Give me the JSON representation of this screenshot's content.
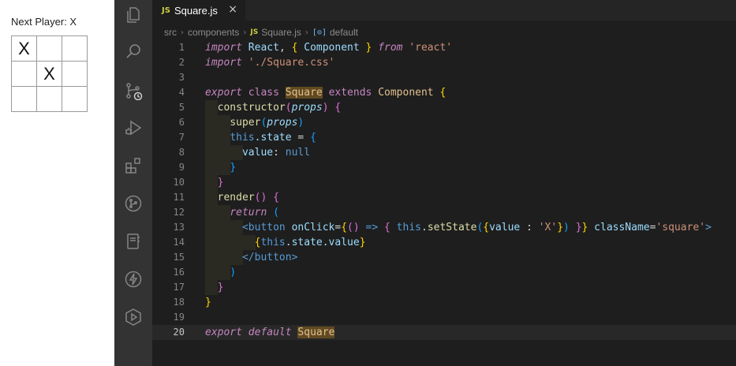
{
  "game": {
    "status": "Next Player: X",
    "board": [
      [
        "X",
        "",
        ""
      ],
      [
        "",
        "X",
        ""
      ],
      [
        "",
        "",
        ""
      ]
    ]
  },
  "activity_bar": [
    "files-icon",
    "search-icon",
    "source-control-icon",
    "run-debug-icon",
    "extensions-icon",
    "github-icon",
    "notebook-icon",
    "lightning-icon",
    "play-icon"
  ],
  "tab": {
    "badge": "JS",
    "name": "Square.js",
    "close": "×"
  },
  "breadcrumb": {
    "items": [
      "src",
      "components",
      "Square.js",
      "default"
    ],
    "js_badge": "JS",
    "symbol_icon": "[⊙]"
  },
  "code": {
    "line_numbers": [
      "1",
      "2",
      "3",
      "4",
      "5",
      "6",
      "7",
      "8",
      "9",
      "10",
      "11",
      "12",
      "13",
      "14",
      "15",
      "16",
      "17",
      "18",
      "19",
      "20"
    ],
    "t": {
      "import": "import",
      "react_ident": "React",
      "comma": ",",
      "lbrace": "{",
      "rbrace": "}",
      "component": "Component",
      "from": "from",
      "react_str": "'react'",
      "css_str": "'./Square.css'",
      "export": "export",
      "class": "class",
      "square": "Square",
      "extends": "extends",
      "constructor": "constructor",
      "lparen": "(",
      "rparen": ")",
      "props": "props",
      "super": "super",
      "this": "this",
      "dot_state": ".state",
      "eq": "=",
      "value": "value",
      "colon": ":",
      "null": "null",
      "render": "render",
      "return": "return",
      "lt": "<",
      "button": "button",
      "onclick": "onClick",
      "arrow": "=>",
      "set_state": "setState",
      "x_str": "'X'",
      "classname": "className",
      "square_str": "'square'",
      "gt": ">",
      "state_value": "state.value",
      "close_button": "</button>",
      "default": "default"
    }
  },
  "colors": {
    "editor_bg": "#1e1e1e",
    "activity_bg": "#333333",
    "keyword": "#c586c0",
    "class": "#e2c08d",
    "string": "#ce9178",
    "variable": "#9cdcfe"
  }
}
